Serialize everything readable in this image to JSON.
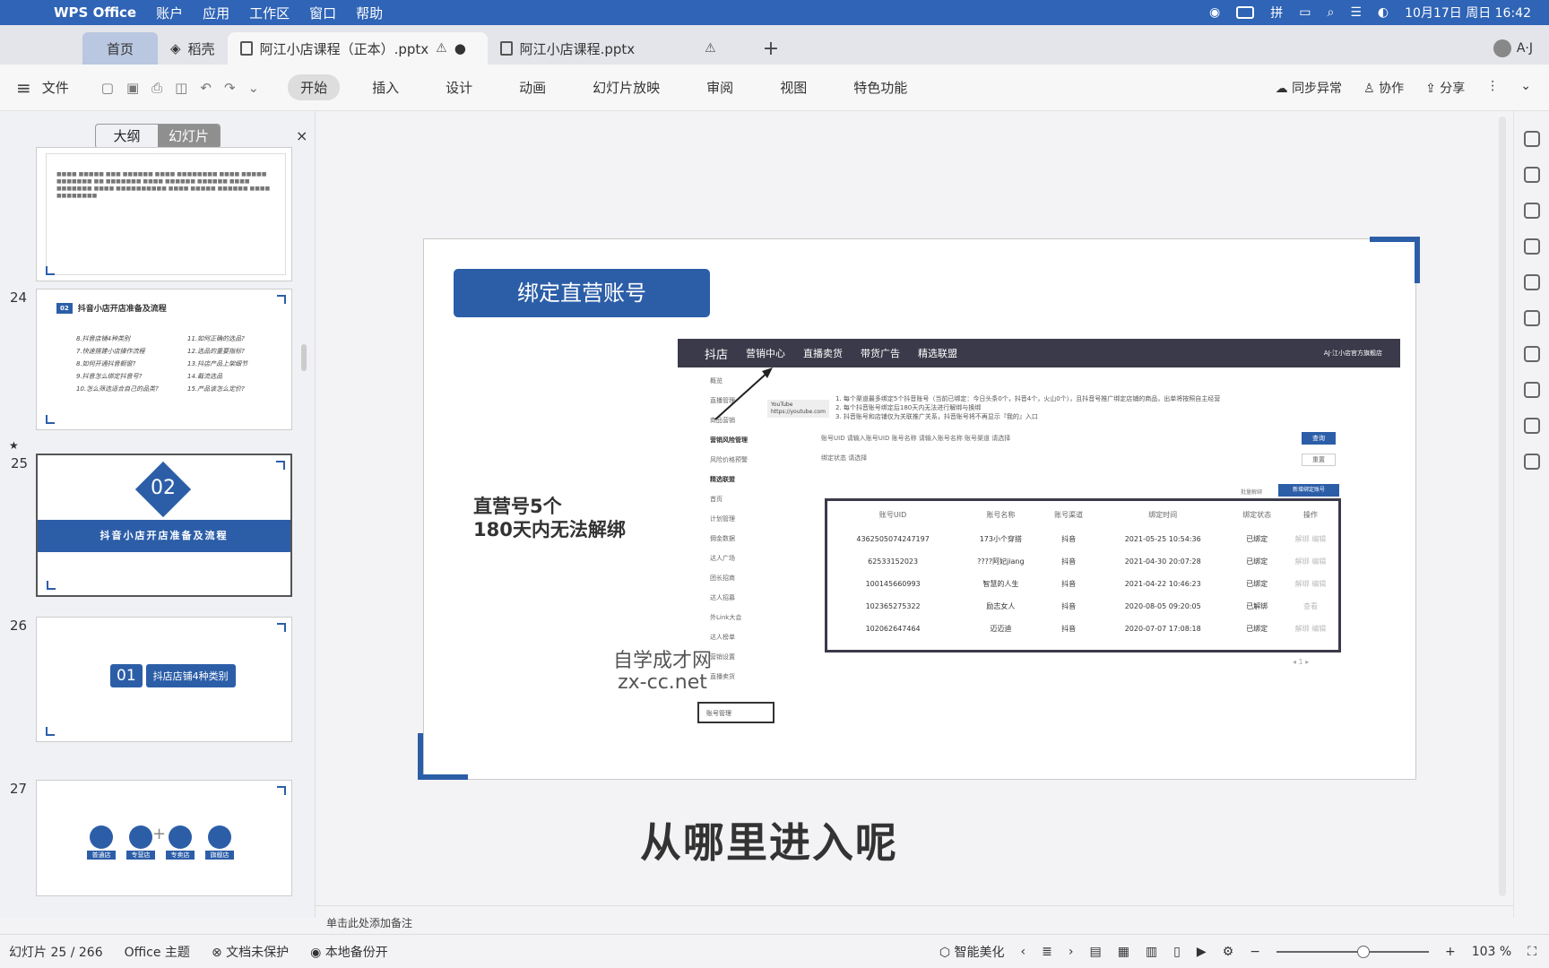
{
  "menubar": {
    "app": "WPS Office",
    "items": [
      "账户",
      "应用",
      "工作区",
      "窗口",
      "帮助"
    ],
    "datetime": "10月17日 周日  16:42",
    "tray_text": "拼"
  },
  "tabs": {
    "home": "首页",
    "docer": "稻壳",
    "active": "阿江小店课程（正本）.pptx",
    "other": "阿江小店课程.pptx",
    "add": "+",
    "avatar": "A·J"
  },
  "toolbar": {
    "file": "文件",
    "ribbon": [
      "开始",
      "插入",
      "设计",
      "动画",
      "幻灯片放映",
      "审阅",
      "视图",
      "特色功能"
    ],
    "sync": "同步异常",
    "collab": "协作",
    "share": "分享"
  },
  "panel": {
    "outline": "大纲",
    "slides": "幻灯片",
    "close": "×",
    "add": "+"
  },
  "thumbs": {
    "n24": "24",
    "n25": "25",
    "n26": "26",
    "n27": "27",
    "t24_title": "抖音小店开店准备及流程",
    "t24_tag": "02",
    "t24_left": [
      "8.抖音店铺4种类别",
      "7.快速搭建小店操作流程",
      "8.如何开通抖音橱窗?",
      "9.抖音怎么绑定抖音号?",
      "10.怎么筛选适合自己的品类?"
    ],
    "t24_right": [
      "11.如何正确的选品?",
      "12.选品的重要指标?",
      "13.抖店产品上架细节",
      "14.截流选品",
      "15.产品该怎么定价?"
    ],
    "t25_num": "02",
    "t25_band": "抖音小店开店准备及流程",
    "t26_num": "01",
    "t26_label": "抖店店铺4种类别",
    "t27_labels": [
      "普通店",
      "专营店",
      "专卖店",
      "旗舰店"
    ]
  },
  "slide": {
    "title": "绑定直营账号",
    "note_line1": "直营号5个",
    "note_line2": "180天内无法解绑",
    "subtitle": "从哪里进入呢",
    "watermark1": "自学成才网",
    "watermark2": "zx-cc.net"
  },
  "shot": {
    "brand": "抖店",
    "center": "营销中心",
    "nav1": "直播卖货",
    "nav2": "带货广告",
    "nav3": "精选联盟",
    "account": "AJ·江小店官方旗舰店",
    "left_nav": [
      "概览",
      "直播管理",
      "商品营销",
      "营销风险管理",
      "风险价格预警",
      "精选联盟",
      "首页",
      "计划管理",
      "佣金数据",
      "达人广场",
      "团长招商",
      "达人招募",
      "外Link大会",
      "达人榜单",
      "营销设置",
      "直播卖货"
    ],
    "notes": [
      "1. 每个渠道最多绑定5个抖音账号（当前已绑定：今日头条0个，抖音4个，火山0个），且抖音号推广绑定店铺的商品，出单将按照自主经营",
      "2. 每个抖音账号绑定后180天内无法进行解绑与换绑",
      "3. 抖音账号和店铺仅为关联推广关系，抖音账号将不再显示『我的』入口"
    ],
    "filters": "账号UID    请输入账号UID          账号名称   请输入账号名称          账号渠道   请选择",
    "filter2": "绑定状态   请选择",
    "query": "查询",
    "reset": "重置",
    "side": "批量解绑",
    "new": "新增绑定账号",
    "headers": [
      "账号UID",
      "账号名称",
      "账号渠道",
      "绑定时间",
      "绑定状态",
      "操作"
    ],
    "rows": [
      [
        "4362505074247197",
        "173小个穿搭",
        "抖音",
        "2021-05-25 10:54:36",
        "已绑定",
        "解绑 编辑"
      ],
      [
        "62533152023",
        "????阿妃jiang",
        "抖音",
        "2021-04-30 20:07:28",
        "已绑定",
        "解绑 编辑"
      ],
      [
        "100145660993",
        "智慧的人生",
        "抖音",
        "2021-04-22 10:46:23",
        "已绑定",
        "解绑 编辑"
      ],
      [
        "102365275322",
        "励志女人",
        "抖音",
        "2020-08-05 09:20:05",
        "已解绑",
        "查看"
      ],
      [
        "102062647464",
        "迈迈迪",
        "抖音",
        "2020-07-07 17:08:18",
        "已绑定",
        "解绑 编辑"
      ]
    ],
    "account_menu": "账号管理",
    "tooltip1": "YouTube",
    "tooltip2": "https://youtube.com"
  },
  "notes_placeholder": "单击此处添加备注",
  "status": {
    "slide": "幻灯片 25 / 266",
    "theme": "Office 主题",
    "protect": "文档未保护",
    "backup": "本地备份开",
    "beautify": "智能美化",
    "zoom": "103 %"
  }
}
